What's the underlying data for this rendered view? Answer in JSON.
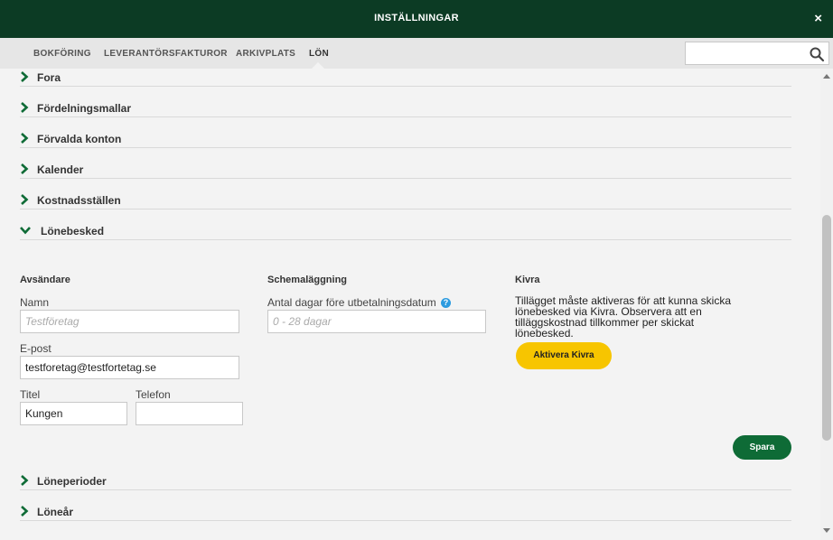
{
  "window": {
    "title": "INSTÄLLNINGAR",
    "close_label": "×"
  },
  "tabs": [
    {
      "label": "BOKFÖRING"
    },
    {
      "label": "LEVERANTÖRSFAKTUROR"
    },
    {
      "label": "ARKIVPLATS"
    },
    {
      "label": "LÖN",
      "active": true
    }
  ],
  "search": {
    "value": "",
    "placeholder": ""
  },
  "sections": {
    "fora": "Fora",
    "fordelningsmallar": "Fördelningsmallar",
    "forvalda_konton": "Förvalda konton",
    "kalender": "Kalender",
    "kostnadsstallen": "Kostnadsställen",
    "lonebesked": "Lönebesked",
    "loneperioder": "Löneperioder",
    "lonear": "Löneår"
  },
  "lonebesked": {
    "avsandare": {
      "heading": "Avsändare",
      "namn_label": "Namn",
      "namn_placeholder": "Testföretag",
      "namn_value": "",
      "epost_label": "E-post",
      "epost_value": "testforetag@testfortetag.se",
      "titel_label": "Titel",
      "titel_value": "Kungen",
      "telefon_label": "Telefon",
      "telefon_value": ""
    },
    "schemalaggning": {
      "heading": "Schemaläggning",
      "dagar_label": "Antal dagar före utbetalningsdatum",
      "dagar_placeholder": "0 - 28 dagar",
      "dagar_value": "",
      "help_glyph": "?"
    },
    "kivra": {
      "heading": "Kivra",
      "text_lines": [
        "Tillägget måste aktiveras för att kunna skicka",
        "lönebesked via Kivra. Observera att en",
        "tilläggskostnad tillkommer per skickat",
        "lönebesked."
      ],
      "button_label": "Aktivera Kivra"
    },
    "save_label": "Spara"
  },
  "colors": {
    "titlebar": "#0c3b24",
    "chevron": "#0e6b36",
    "kivra_button": "#f7c500",
    "save_button": "#0e6b36",
    "help_icon": "#2c9be0"
  }
}
